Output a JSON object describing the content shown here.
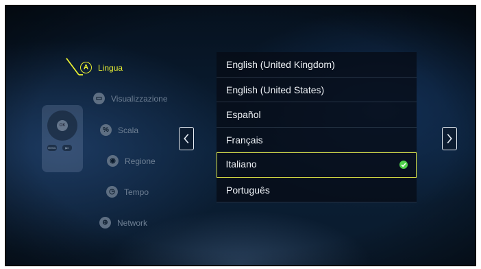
{
  "menu": {
    "items": [
      {
        "label": "Lingua",
        "icon": "language-icon",
        "glyph": "A",
        "active": true
      },
      {
        "label": "Visualizzazione",
        "icon": "display-icon",
        "glyph": "▭",
        "active": false
      },
      {
        "label": "Scala",
        "icon": "scale-icon",
        "glyph": "%",
        "active": false
      },
      {
        "label": "Regione",
        "icon": "location-icon",
        "glyph": "◉",
        "active": false
      },
      {
        "label": "Tempo",
        "icon": "clock-icon",
        "glyph": "◷",
        "active": false
      },
      {
        "label": "Network",
        "icon": "globe-icon",
        "glyph": "⊕",
        "active": false
      }
    ]
  },
  "remote": {
    "ok_label": "OK",
    "menu_label": "MENU",
    "play_label": "▶II"
  },
  "languages": {
    "items": [
      "English (United Kingdom)",
      "English (United States)",
      "Español",
      "Français",
      "Italiano",
      "Português"
    ],
    "selected": "Italiano"
  },
  "colors": {
    "accent": "#e9f033",
    "check": "#4fd14a",
    "background": "#0b2037"
  }
}
